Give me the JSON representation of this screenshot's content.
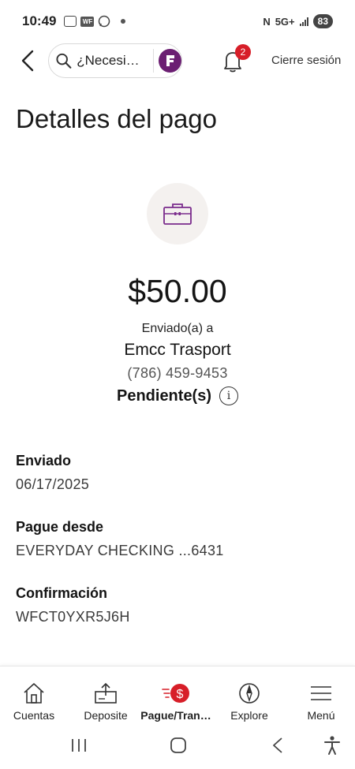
{
  "status_bar": {
    "time": "10:49",
    "network": "5G+",
    "battery": "83"
  },
  "header": {
    "search_placeholder": "¿Necesi…",
    "notification_count": "2",
    "signout_label": "Cierre sesión"
  },
  "page": {
    "title": "Detalles del pago"
  },
  "payment": {
    "amount": "$50.00",
    "sent_to_label": "Enviado(a) a",
    "payee_name": "Emcc Trasport",
    "payee_phone": "(786) 459-9453",
    "status": "Pendiente(s)"
  },
  "details": [
    {
      "label": "Enviado",
      "value": "06/17/2025"
    },
    {
      "label": "Pague desde",
      "value": "EVERYDAY CHECKING ...6431"
    },
    {
      "label": "Confirmación",
      "value": "WFCT0YXR5J6H"
    }
  ],
  "bottom_nav": [
    {
      "label": "Cuentas",
      "icon": "home-icon"
    },
    {
      "label": "Deposite",
      "icon": "deposit-icon"
    },
    {
      "label": "Pague/Tran…",
      "icon": "pay-transfer-icon",
      "active": true
    },
    {
      "label": "Explore",
      "icon": "compass-icon"
    },
    {
      "label": "Menú",
      "icon": "menu-icon"
    }
  ],
  "colors": {
    "accent_red": "#d71e28",
    "brand_purple": "#6b1f72",
    "icon_purple": "#7a2b8c"
  }
}
